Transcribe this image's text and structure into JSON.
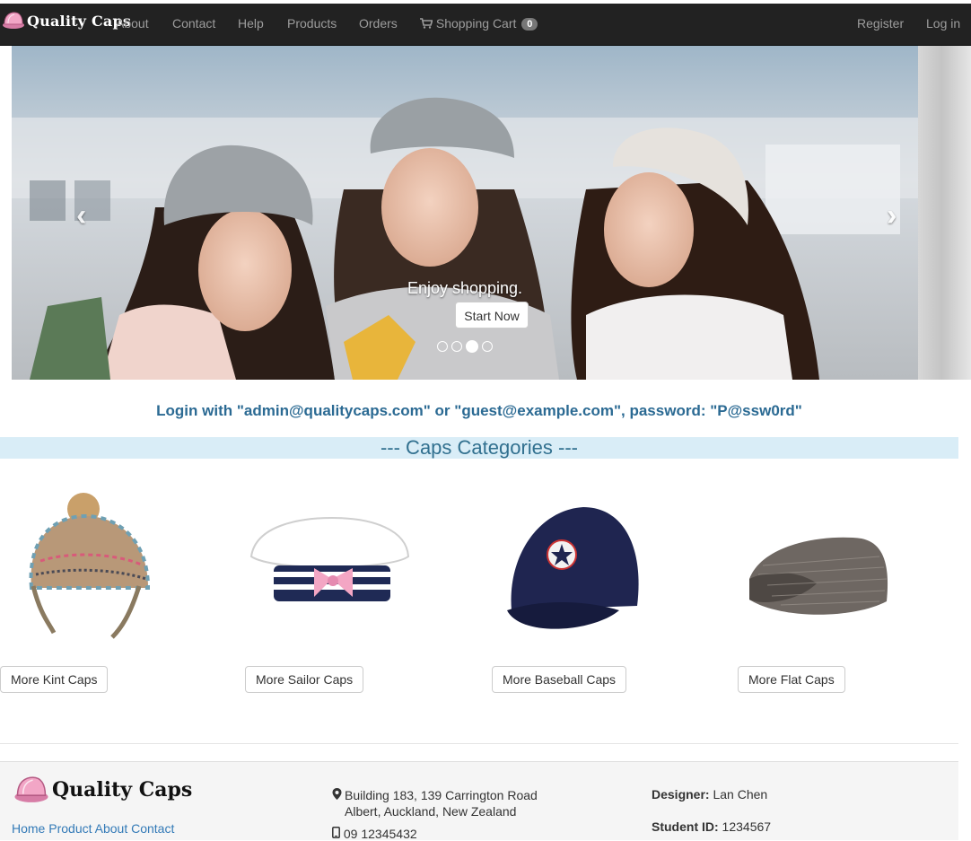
{
  "navbar": {
    "brand": "Quality Caps",
    "items": [
      {
        "label": "About"
      },
      {
        "label": "Contact"
      },
      {
        "label": "Help"
      },
      {
        "label": "Products"
      },
      {
        "label": "Orders"
      }
    ],
    "cart_label": "Shopping Cart",
    "cart_count": "0",
    "register": "Register",
    "login": "Log in"
  },
  "carousel": {
    "caption": "Enjoy shopping.",
    "button": "Start Now",
    "active_slide": 3,
    "slide_count": 4
  },
  "login_note": "Login with \"admin@qualitycaps.com\" or \"guest@example.com\", password: \"P@ssw0rd\"",
  "categories": {
    "title": "--- Caps Categories ---",
    "buttons": [
      "More Kint Caps",
      "More Sailor Caps",
      "More Baseball Caps",
      "More Flat Caps"
    ]
  },
  "footer": {
    "brand": "Quality Caps",
    "links": [
      "Home",
      "Product",
      "About",
      "Contact"
    ],
    "address_line1": "Building 183, 139 Carrington Road",
    "address_line2": "Albert, Auckland, New Zealand",
    "phone": "09 12345432",
    "designer_label": "Designer:",
    "designer": "Lan Chen",
    "student_label": "Student ID:",
    "student_id": "1234567"
  },
  "colors": {
    "navbar_bg": "#222222",
    "nav_text": "#9d9d9d",
    "note_text": "#2b6a93",
    "category_bar": "#d9edf7",
    "link": "#337ab7"
  }
}
